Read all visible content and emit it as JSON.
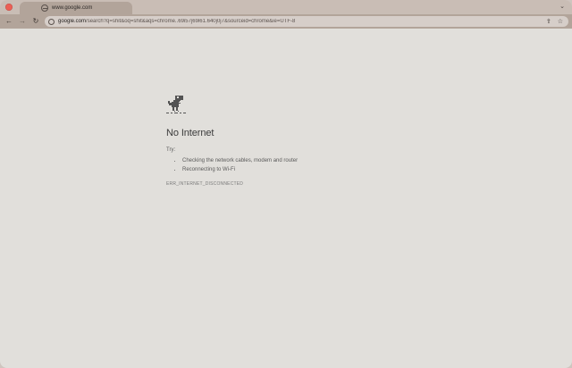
{
  "tab": {
    "title": "www.google.com",
    "menu_icon": "chevron-down-icon"
  },
  "toolbar": {
    "back_icon": "arrow-left-icon",
    "forward_icon": "arrow-right-icon",
    "reload_icon": "reload-icon"
  },
  "omnibox": {
    "host": "google.com",
    "path": "/search?q=shit&oq=shit&aqs=chrome..69i57j69i61.640j0j7&sourceid=chrome&ie=UTF-8",
    "share_icon": "share-icon",
    "bookmark_icon": "star-icon"
  },
  "error": {
    "icon": "dinosaur-icon",
    "heading": "No Internet",
    "try_label": "Try:",
    "suggestions": [
      "Checking the network cables, modem and router",
      "Reconnecting to Wi-Fi"
    ],
    "code": "ERR_INTERNET_DISCONNECTED"
  }
}
